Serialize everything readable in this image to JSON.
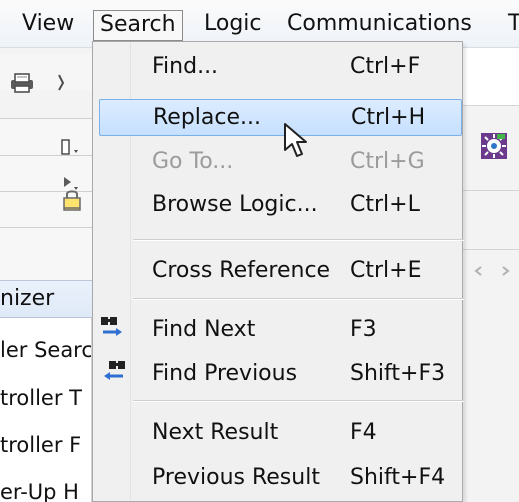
{
  "menubar": {
    "items": [
      "View",
      "Search",
      "Logic",
      "Communications",
      "T"
    ]
  },
  "left_panel": {
    "organizer_label": "nizer",
    "items": [
      "ler Searc",
      "troller T",
      "troller F",
      "er-Up H"
    ]
  },
  "search_menu": {
    "items": [
      {
        "label": "Find...",
        "shortcut": "Ctrl+F",
        "state": "normal"
      },
      {
        "label": "Replace...",
        "shortcut": "Ctrl+H",
        "state": "selected"
      },
      {
        "label": "Go To...",
        "shortcut": "Ctrl+G",
        "state": "disabled"
      },
      {
        "label": "Browse Logic...",
        "shortcut": "Ctrl+L",
        "state": "normal"
      },
      {
        "label": "Cross Reference",
        "shortcut": "Ctrl+E",
        "state": "normal"
      },
      {
        "label": "Find Next",
        "shortcut": "F3",
        "state": "normal",
        "icon": "binoculars-next-icon"
      },
      {
        "label": "Find Previous",
        "shortcut": "Shift+F3",
        "state": "normal",
        "icon": "binoculars-previous-icon"
      },
      {
        "label": "Next Result",
        "shortcut": "F4",
        "state": "normal"
      },
      {
        "label": "Previous Result",
        "shortcut": "Shift+F4",
        "state": "normal"
      }
    ]
  },
  "colors": {
    "selection_fill": "#c6e0ff",
    "selection_border": "#7ab1ea",
    "disabled_text": "#9b9b9b",
    "menu_background": "#f0f0f0"
  },
  "icons": {
    "printer": "printer-icon",
    "cursor": "mouse-pointer-icon",
    "lock": "lock-icon",
    "cog": "cog-icon"
  }
}
